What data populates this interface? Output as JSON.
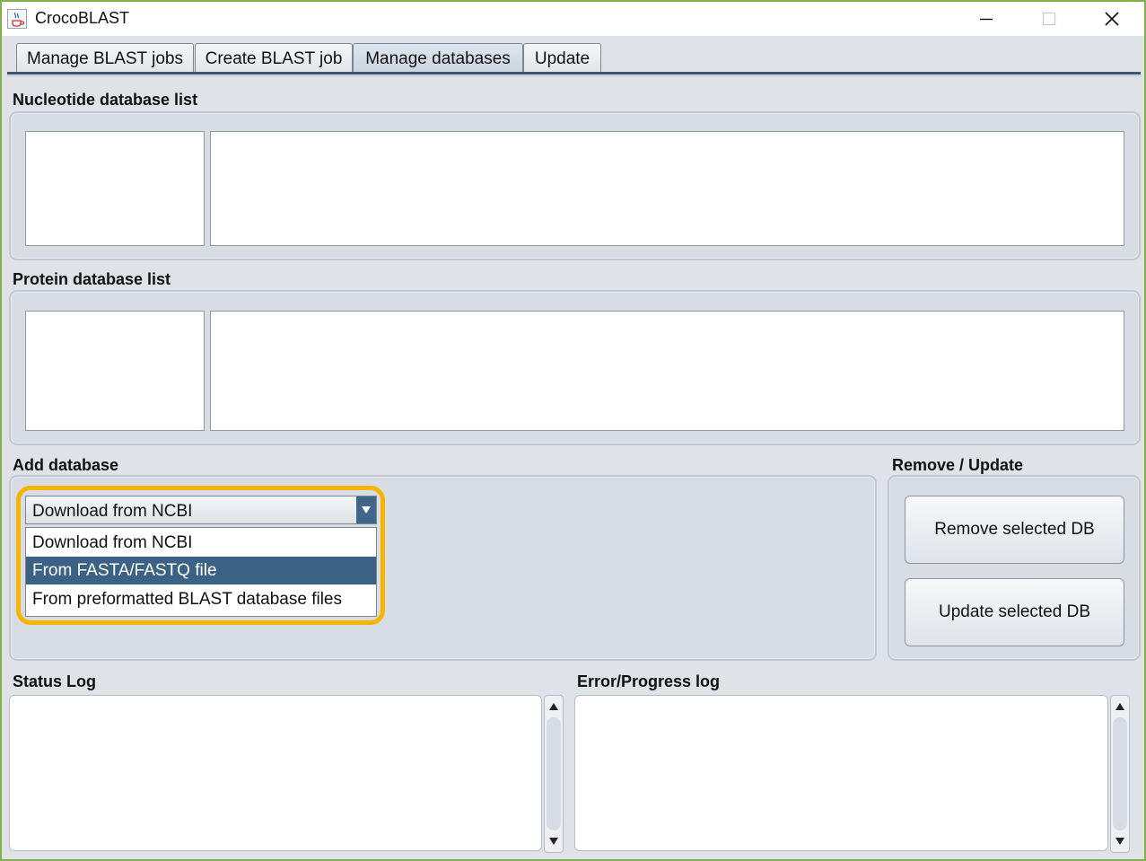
{
  "window": {
    "title": "CrocoBLAST",
    "icons": {
      "app": "java-cup-icon",
      "minimize": "minimize-icon",
      "maximize": "maximize-icon",
      "close": "close-icon"
    }
  },
  "tabs": [
    {
      "label": "Manage BLAST jobs",
      "active": false
    },
    {
      "label": "Create BLAST job",
      "active": false
    },
    {
      "label": "Manage databases",
      "active": true
    },
    {
      "label": "Update",
      "active": false
    }
  ],
  "sections": {
    "nucleotide": "Nucleotide database list",
    "protein": "Protein database list",
    "add": "Add database",
    "remove_update": "Remove / Update",
    "status_log": "Status Log",
    "error_log": "Error/Progress log"
  },
  "add_database": {
    "selected": "Download from NCBI",
    "options": [
      "Download from NCBI",
      "From FASTA/FASTQ file",
      "From preformatted BLAST database files"
    ],
    "highlighted_option_index": 1
  },
  "buttons": {
    "remove": "Remove selected DB",
    "update": "Update selected DB"
  },
  "colors": {
    "accent": "#3b6284",
    "highlight_ring": "#f5b400",
    "window_border": "#7fb24a"
  }
}
